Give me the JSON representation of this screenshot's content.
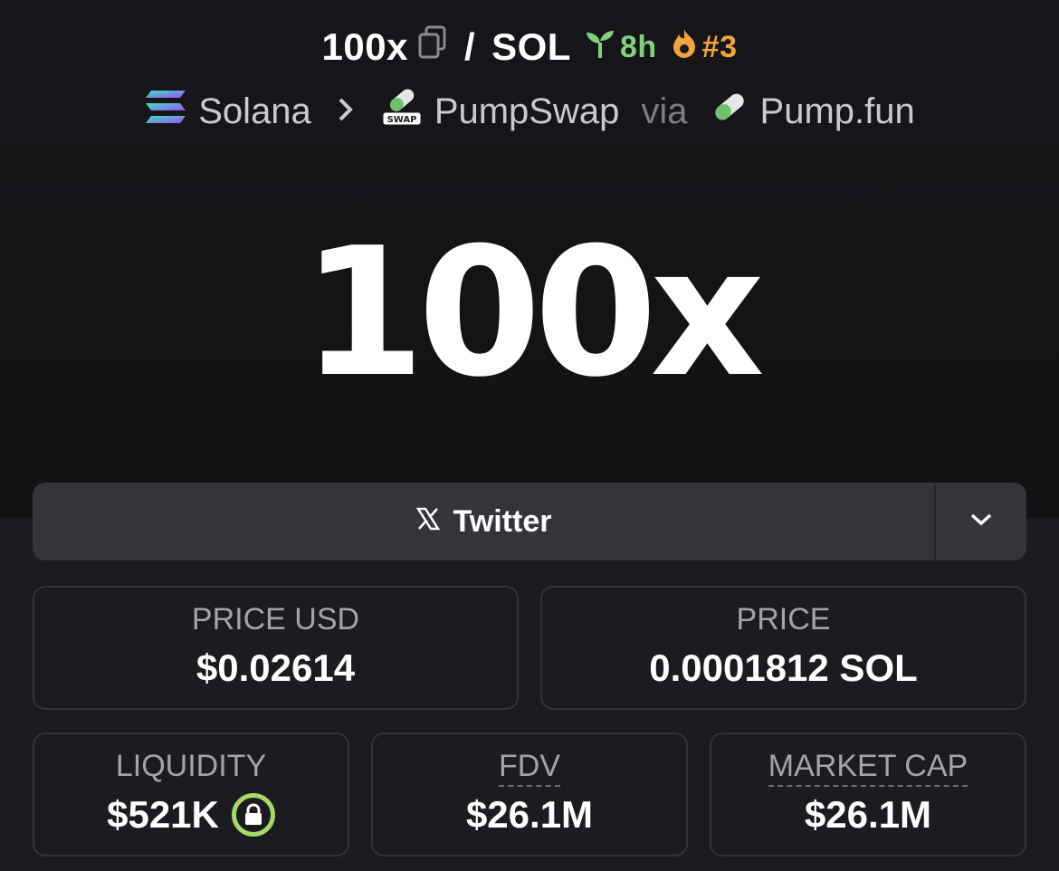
{
  "header": {
    "token_symbol": "100x",
    "separator": "/",
    "quote_symbol": "SOL",
    "age": "8h",
    "rank": "#3",
    "chain": "Solana",
    "dex": "PumpSwap",
    "via_label": "via",
    "launchpad": "Pump.fun",
    "dex_icon_text": "SWAP"
  },
  "banner": {
    "text": "100x"
  },
  "social": {
    "twitter_label": "Twitter"
  },
  "stats": {
    "price_usd_label": "PRICE USD",
    "price_usd_value": "$0.02614",
    "price_label": "PRICE",
    "price_value": "0.0001812 SOL",
    "liquidity_label": "LIQUIDITY",
    "liquidity_value": "$521K",
    "fdv_label": "FDV",
    "fdv_value": "$26.1M",
    "mcap_label": "MARKET CAP",
    "mcap_value": "$26.1M"
  },
  "colors": {
    "age_green": "#7fd17f",
    "rank_orange": "#f2a33a",
    "lock_green": "#a6d86a"
  }
}
